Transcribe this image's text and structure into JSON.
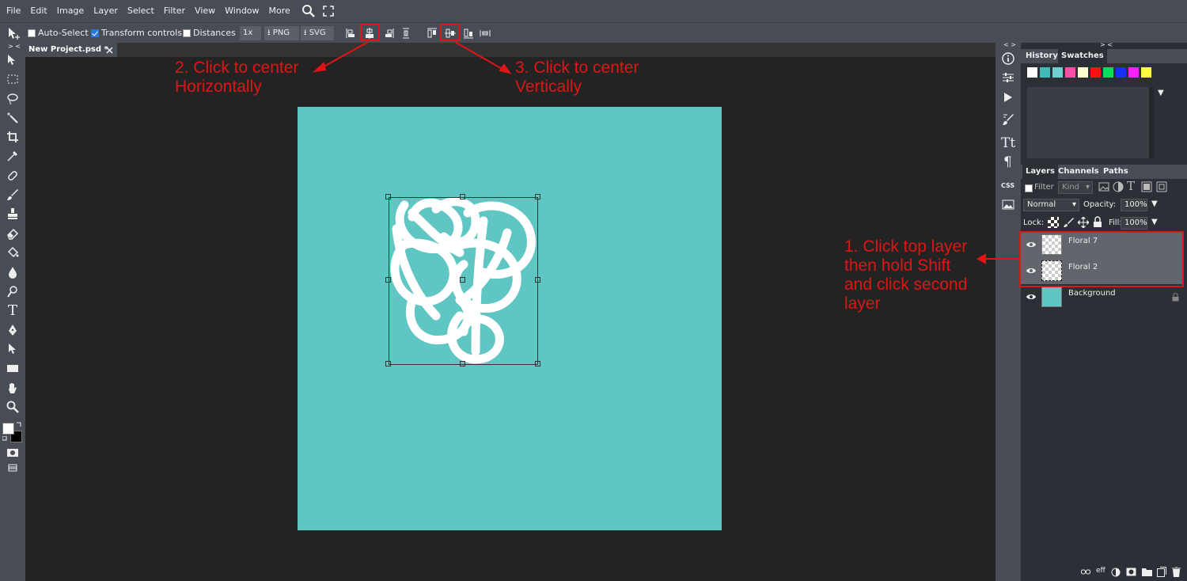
{
  "menu": [
    "File",
    "Edit",
    "Image",
    "Layer",
    "Select",
    "Filter",
    "View",
    "Window",
    "More"
  ],
  "options": {
    "auto_select": "Auto-Select",
    "auto_select_checked": false,
    "transform_controls": "Transform controls",
    "transform_controls_checked": true,
    "distances": "Distances",
    "distances_checked": false,
    "scale": "1x",
    "png": "PNG",
    "svg": "SVG"
  },
  "doc_tab": "New Project.psd *",
  "right_panel": {
    "history_tabs": [
      "History",
      "Swatches"
    ],
    "swatches": [
      "#ffffff",
      "#3fbcb8",
      "#6fcfd0",
      "#ff4fa8",
      "#ffffd0",
      "#ff1010",
      "#00e05a",
      "#1830ff",
      "#ff20ff",
      "#ffff40"
    ],
    "layers_tabs": [
      "Layers",
      "Channels",
      "Paths"
    ],
    "filter_label": "Filter",
    "kind_label": "Kind",
    "blend_mode": "Normal",
    "opacity_label": "Opacity:",
    "opacity_value": "100%",
    "lock_label": "Lock:",
    "fill_label": "Fill:",
    "fill_value": "100%",
    "layers": [
      {
        "name": "Floral 7",
        "selected": true
      },
      {
        "name": "Floral 2",
        "selected": true
      },
      {
        "name": "Background",
        "selected": false
      }
    ],
    "footer_eff": "eff"
  },
  "right_strip": {
    "css_label": "CSS"
  },
  "annotations": {
    "step1": [
      "1. Click top layer",
      "then hold Shift",
      "and click second",
      "layer"
    ],
    "step2": [
      "2. Click to center",
      "Horizontally"
    ],
    "step3": [
      "3. Click to center",
      "Vertically"
    ],
    "color": "#e01515"
  },
  "colors": {
    "canvas": "#5fc6c3",
    "ui_bg": "#474c55",
    "workspace": "#232323"
  }
}
